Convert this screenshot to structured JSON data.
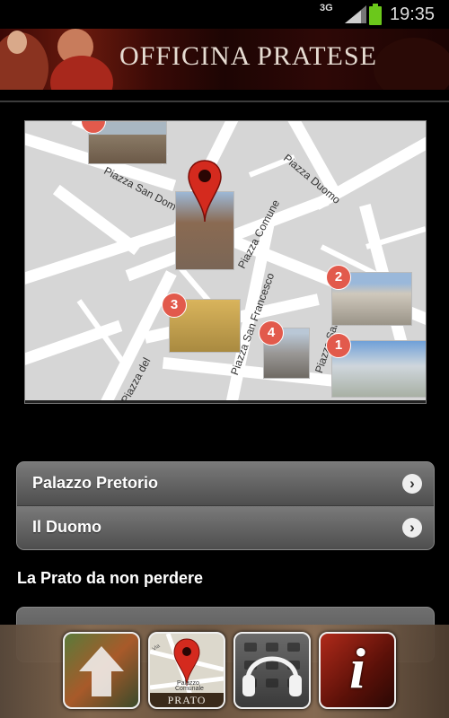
{
  "status_bar": {
    "network": "3G",
    "time": "19:35"
  },
  "header": {
    "title": "OFFICINA PRATESE"
  },
  "map": {
    "streets": [
      "Piazza San Domenico",
      "Piazza Duomo",
      "Piazza Comune",
      "Piazza San Francesco",
      "Piazza San",
      "Piazza del"
    ],
    "markers": [
      "1",
      "2",
      "3",
      "4"
    ]
  },
  "list": [
    {
      "label": "Palazzo Pretorio"
    },
    {
      "label": "Il Duomo"
    }
  ],
  "section": {
    "title": "La Prato da non perdere"
  },
  "tabs": [
    {
      "name": "home",
      "caption": ""
    },
    {
      "name": "map",
      "caption": "PRATO",
      "map_text": [
        "Via",
        "Palazzo",
        "Comunale"
      ]
    },
    {
      "name": "audio",
      "caption": ""
    },
    {
      "name": "info",
      "caption": "i"
    }
  ],
  "colors": {
    "accent_red": "#e25a4c",
    "banner_red": "#6a1a0e",
    "pin_red": "#d42a1e"
  }
}
